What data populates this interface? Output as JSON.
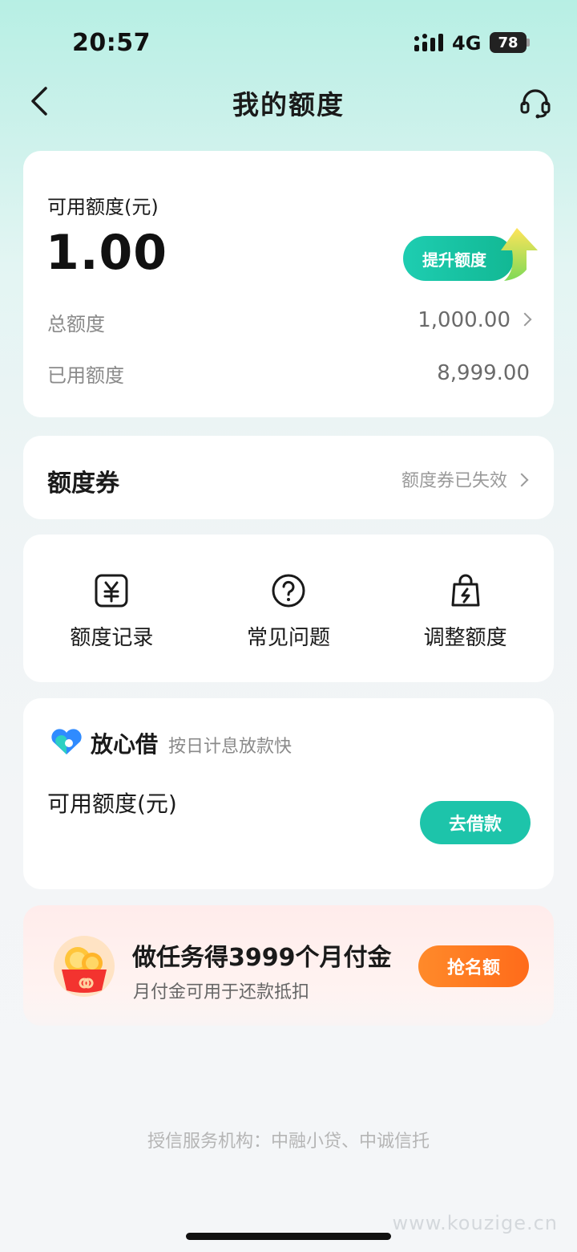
{
  "status_bar": {
    "time": "20:57",
    "network": "4G",
    "battery": "78"
  },
  "nav": {
    "title": "我的额度",
    "back_icon": "chevron-left-icon",
    "service_icon": "headset-icon"
  },
  "quota": {
    "available_label": "可用额度(元)",
    "available_amount": "1.00",
    "raise_button": "提升额度",
    "total_label": "总额度",
    "total_value": "1,000.00",
    "used_label": "已用额度",
    "used_value": "8,999.00"
  },
  "coupon": {
    "title": "额度券",
    "status": "额度券已失效"
  },
  "actions": [
    {
      "label": "额度记录",
      "icon": "yuan-record-icon"
    },
    {
      "label": "常见问题",
      "icon": "question-circle-icon"
    },
    {
      "label": "调整额度",
      "icon": "bag-lightning-icon"
    }
  ],
  "loan": {
    "brand": "放心借",
    "slogan": "按日计息放款快",
    "available_label": "可用额度(元)",
    "borrow_button": "去借款"
  },
  "promo": {
    "title": "做任务得3999个月付金",
    "subtitle": "月付金可用于还款抵扣",
    "button": "抢名额"
  },
  "footer": {
    "text": "授信服务机构：中融小贷、中诚信托"
  },
  "watermark": "www.kouzige.cn",
  "colors": {
    "accent": "#1dc4aa",
    "promo_button": "#ff7a22",
    "promo_bg": "#ffeceb"
  }
}
